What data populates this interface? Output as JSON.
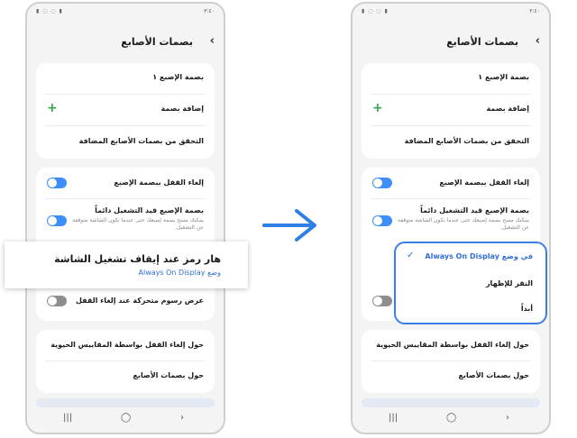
{
  "status": {
    "time": "٣:٤٠",
    "icons_left": "▮ ◌ ◌ ▮"
  },
  "header": {
    "title": "بصمات الأصابع",
    "back_glyph": "‹"
  },
  "list": {
    "fingerprint1": "بصمة الإصبع ١",
    "add_fingerprint": "إضافة بصمة",
    "check_added": "التحقق من بصمات الأصابع المضافة",
    "unlock_fingerprint": "إلغاء القفل ببصمة الإصبع",
    "always_on": "بصمة الإصبع قيد التشغيل دائماً",
    "always_on_sub": "يمكنك مسح بصمة إصبعك حتى عندما تكون الشاشة متوقفة عن التشغيل.",
    "show_animation": "عرض رسوم متحركة عند إلغاء القفل",
    "about_biometrics": "حول إلغاء القفل بواسطة المقاييس الحيوية",
    "about_fingerprints": "حول بصمات الأصابع"
  },
  "popout": {
    "title": "هار رمز عند إيقاف تشغيل الشاشة",
    "subtitle": "وضع Always On Display"
  },
  "dropdown": {
    "options": [
      "في وضع Always On Display",
      "النقر للإظهار",
      "أبداً"
    ],
    "selected_index": 0
  },
  "nav": {
    "recent": "|||",
    "home": "◯",
    "back": "›"
  },
  "colors": {
    "accent": "#3a7ee6",
    "plus": "#2eaa4a"
  }
}
